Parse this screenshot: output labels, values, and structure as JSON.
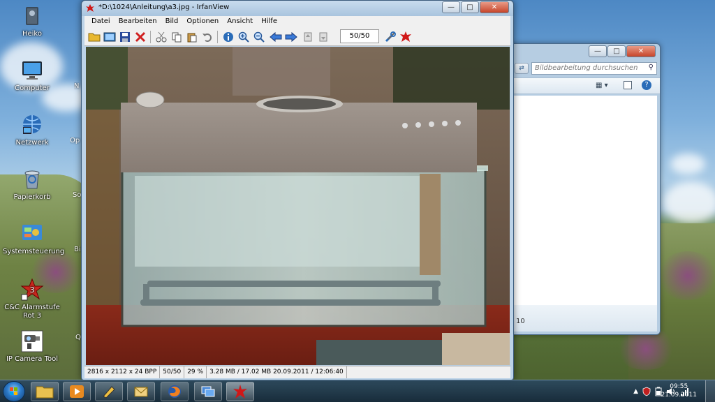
{
  "desktop": {
    "icons": [
      {
        "label": "Heiko",
        "icon": "user-folder-icon"
      },
      {
        "label": "Computer",
        "icon": "computer-icon"
      },
      {
        "label": "Netzwerk",
        "icon": "network-icon"
      },
      {
        "label": "Papierkorb",
        "icon": "recycle-bin-icon"
      },
      {
        "label": "Systemsteuerung",
        "icon": "control-panel-icon"
      },
      {
        "label": "C&C Alarmstufe Rot 3",
        "icon": "game-shortcut-icon"
      },
      {
        "label": "IP Camera Tool",
        "icon": "ip-camera-icon"
      }
    ],
    "partial_labels": [
      "N",
      "Op",
      "So\nG",
      "Bil",
      "Q"
    ]
  },
  "explorer": {
    "search_placeholder": "Bildbearbeitung durchsuchen",
    "details_fragment": "10"
  },
  "irfanview": {
    "title": "*D:\\1024\\Anleitung\\a3.jpg - IrfanView",
    "menu": [
      "Datei",
      "Bearbeiten",
      "Bild",
      "Optionen",
      "Ansicht",
      "Hilfe"
    ],
    "page_counter": "50/50",
    "status": {
      "dimensions": "2816 x 2112 x 24 BPP",
      "page": "50/50",
      "zoom": "29 %",
      "fileinfo": "3.28 MB / 17.02 MB 20.09.2011 / 12:06:40"
    }
  },
  "taskbar": {
    "time": "09:55",
    "date": "21.09.2011"
  },
  "colors": {
    "taskbar": "#1e3a55",
    "irfan_frame": "#bcd3e8",
    "close_red": "#c6452a"
  }
}
